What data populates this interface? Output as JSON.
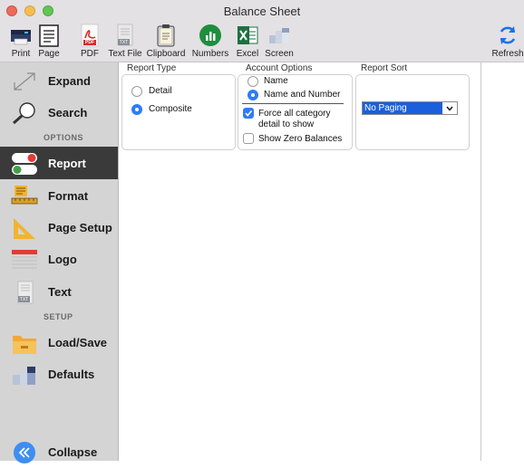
{
  "window": {
    "title": "Balance Sheet"
  },
  "toolbar": {
    "items": [
      {
        "label": "Print",
        "icon": "printer-icon"
      },
      {
        "label": "Page",
        "icon": "page-icon"
      },
      {
        "label": "PDF",
        "icon": "pdf-icon"
      },
      {
        "label": "Text File",
        "icon": "text-file-icon"
      },
      {
        "label": "Clipboard",
        "icon": "clipboard-icon"
      },
      {
        "label": "Numbers",
        "icon": "numbers-icon"
      },
      {
        "label": "Excel",
        "icon": "excel-icon"
      },
      {
        "label": "Screen",
        "icon": "screen-icon"
      },
      {
        "label": "Refresh",
        "icon": "refresh-icon"
      }
    ],
    "pdf_badge": "PDF",
    "txt_badge": "TXT"
  },
  "sidebar": {
    "expand": "Expand",
    "search": "Search",
    "options_header": "OPTIONS",
    "report": "Report",
    "format": "Format",
    "page_setup": "Page Setup",
    "logo": "Logo",
    "text": "Text",
    "text_badge": "TXT",
    "setup_header": "SETUP",
    "load_save": "Load/Save",
    "defaults": "Defaults",
    "collapse": "Collapse",
    "active_item": "Report"
  },
  "report_type": {
    "label": "Report Type",
    "options": [
      {
        "label": "Detail",
        "selected": false
      },
      {
        "label": "Composite",
        "selected": true
      }
    ]
  },
  "account_options": {
    "label": "Account Options",
    "radios": [
      {
        "label": "Name",
        "selected": false
      },
      {
        "label": "Name and Number",
        "selected": true
      }
    ],
    "force_line1": "Force all category",
    "force_line2": "detail to show",
    "force_checked": true,
    "zero_label": "Show Zero Balances",
    "zero_checked": false
  },
  "report_sort": {
    "label": "Report Sort",
    "selected": "No Paging"
  },
  "colors": {
    "accent": "#2f7cf6",
    "sidebar_bg": "#d4d4d4",
    "active_bg": "#3a3a3a",
    "toolbar_bg": "#e3e1e3"
  }
}
